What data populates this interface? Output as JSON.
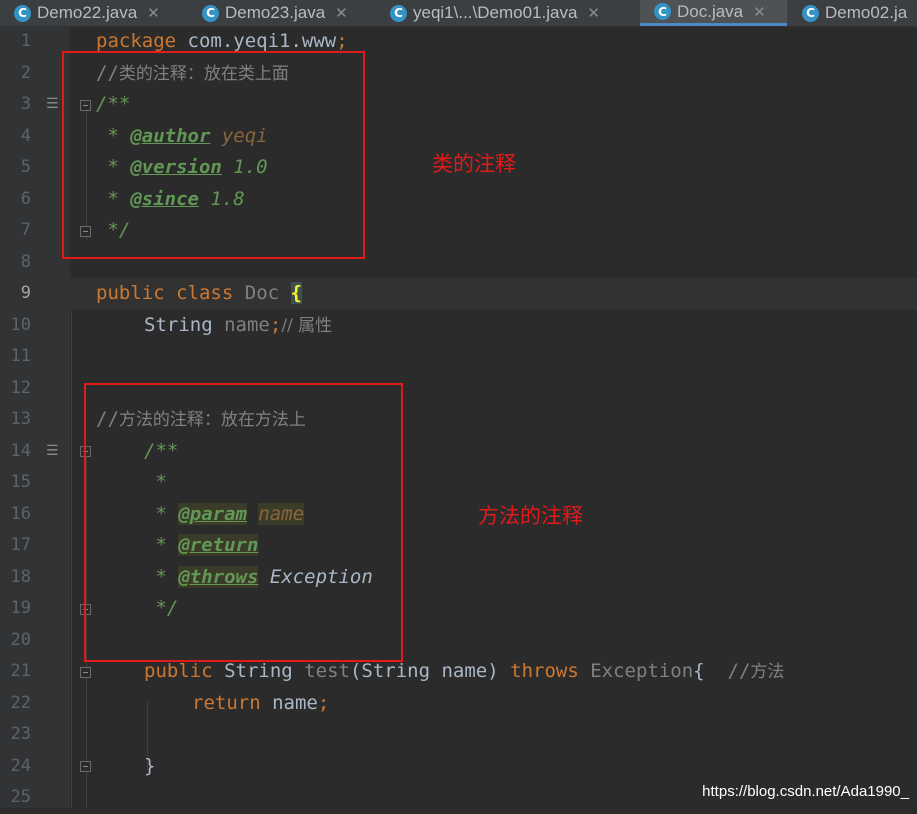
{
  "tabs": [
    {
      "icon": "C",
      "label": "Demo22.java",
      "close": "✕"
    },
    {
      "icon": "C",
      "label": "Demo23.java",
      "close": "✕"
    },
    {
      "icon": "C",
      "label": "yeqi1\\...\\Demo01.java",
      "close": "✕"
    },
    {
      "icon": "C",
      "label": "Doc.java",
      "close": "✕"
    },
    {
      "icon": "C",
      "label": "Demo02.ja",
      "close": ""
    }
  ],
  "active_tab": "Doc.java",
  "line_numbers": [
    "1",
    "2",
    "3",
    "4",
    "5",
    "6",
    "7",
    "8",
    "9",
    "10",
    "11",
    "12",
    "13",
    "14",
    "15",
    "16",
    "17",
    "18",
    "19",
    "20",
    "21",
    "22",
    "23",
    "24",
    "25"
  ],
  "current_line": "9",
  "code": {
    "l1": {
      "kw": "package",
      "rest": " com.yeqi1.www",
      "semi": ";"
    },
    "l2": {
      "slashes": "//",
      "text": "类的注释：放在类上面"
    },
    "l3": {
      "open": "/**"
    },
    "l4": {
      "star": " * ",
      "tag": "@author",
      "value": " yeqi"
    },
    "l5": {
      "star": " * ",
      "tag": "@version",
      "value": " 1.0"
    },
    "l6": {
      "star": " * ",
      "tag": "@since",
      "value": " 1.8"
    },
    "l7": {
      "close": " */"
    },
    "l9": {
      "kw1": "public",
      "kw2": "class",
      "name": "Doc",
      "brace": "{"
    },
    "l10": {
      "type": "String",
      "field": "name",
      "semi": ";",
      "comment": "// 属性"
    },
    "l13": {
      "slashes": "//",
      "text": "方法的注释：放在方法上"
    },
    "l14": {
      "open": "/**"
    },
    "l15": {
      "star": " *"
    },
    "l16": {
      "star": " * ",
      "tag": "@param",
      "value": "name"
    },
    "l17": {
      "star": " * ",
      "tag": "@return"
    },
    "l18": {
      "star": " * ",
      "tag": "@throws",
      "value": " Exception"
    },
    "l19": {
      "close": " */"
    },
    "l21": {
      "kw1": "public",
      "type": "String",
      "method": "test",
      "params": "(String name)",
      "kw2": "throws",
      "exc": "Exception",
      "brace": "{",
      "slashes": "//",
      "comment": "方法"
    },
    "l22": {
      "kw": "return",
      "value": " name",
      "semi": ";"
    },
    "l24": {
      "brace": "}"
    }
  },
  "annotations": {
    "class_comment": "类的注释",
    "method_comment": "方法的注释"
  },
  "watermark": "https://blog.csdn.net/Ada1990_",
  "colors": {
    "editor_bg": "#2b2b2b",
    "keyword": "#cc7832",
    "javadoc": "#629755",
    "comment": "#808080",
    "annotation_red": "#e11a1a",
    "tab_underline": "#4a88c7"
  }
}
